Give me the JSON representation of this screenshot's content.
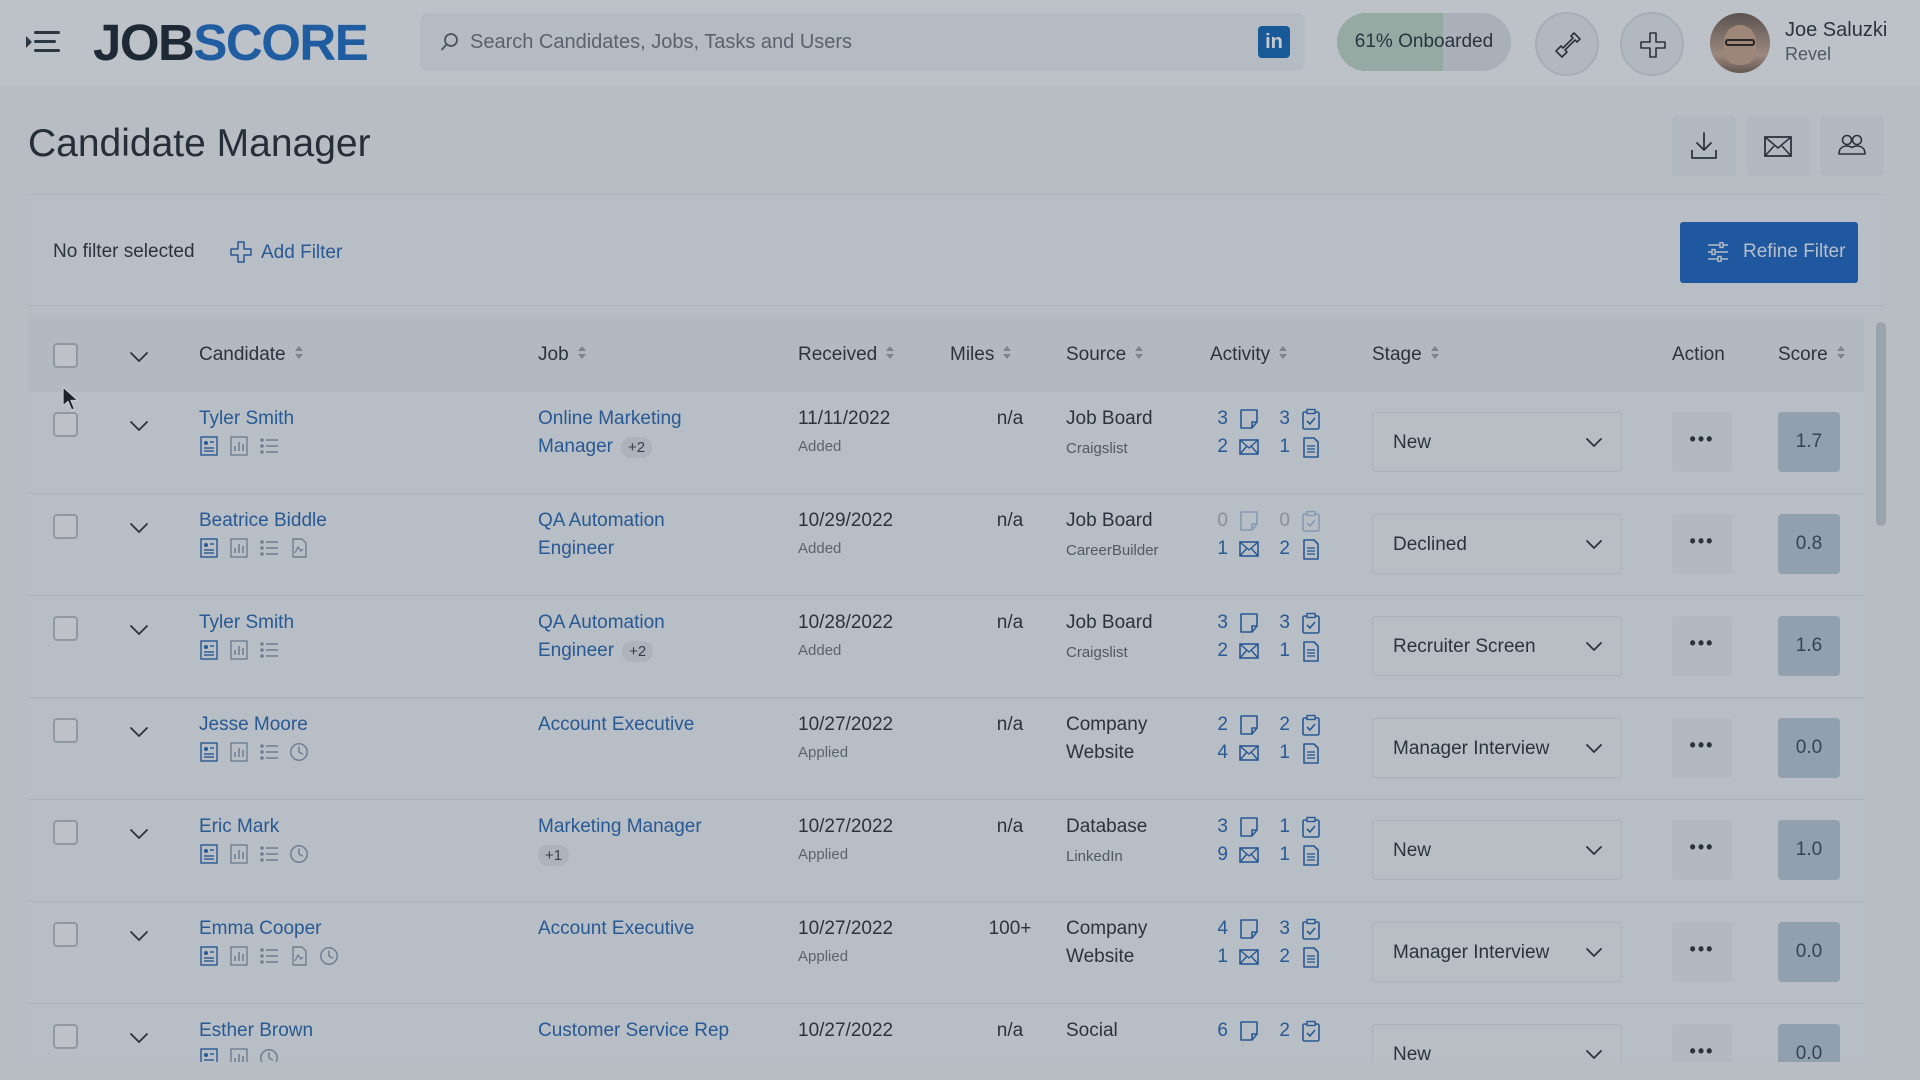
{
  "brand": {
    "logo_part1": "JOB",
    "logo_part2": "SCORE"
  },
  "search": {
    "placeholder": "Search Candidates, Jobs, Tasks and Users",
    "value": ""
  },
  "onboarding": {
    "label": "61% Onboarded",
    "percent": 61
  },
  "user": {
    "name": "Joe Saluzki",
    "org": "Revel"
  },
  "page": {
    "title": "Candidate Manager"
  },
  "filter": {
    "status": "No filter selected",
    "add_label": "Add Filter",
    "refine_label": "Refine Filter"
  },
  "columns": {
    "candidate": "Candidate",
    "job": "Job",
    "received": "Received",
    "miles": "Miles",
    "source": "Source",
    "activity": "Activity",
    "stage": "Stage",
    "action": "Action",
    "score": "Score"
  },
  "rows": [
    {
      "name": "Tyler Smith",
      "icons": [
        "resume-icon",
        "chart-icon",
        "list-icon"
      ],
      "job_l1": "Online Marketing",
      "job_l2": "Manager",
      "job_more": "+2",
      "received": "11/11/2022",
      "received_status": "Added",
      "miles": "n/a",
      "source": "Job Board",
      "source2": "",
      "source_sub": "Craigslist",
      "activity": [
        "3",
        "3",
        "2",
        "1"
      ],
      "stage": "New",
      "score": "1.7"
    },
    {
      "name": "Beatrice Biddle",
      "icons": [
        "resume-icon",
        "chart-icon",
        "list-icon",
        "document-icon"
      ],
      "job_l1": "QA Automation",
      "job_l2": "Engineer",
      "job_more": "",
      "received": "10/29/2022",
      "received_status": "Added",
      "miles": "n/a",
      "source": "Job Board",
      "source2": "",
      "source_sub": "CareerBuilder",
      "activity": [
        "0",
        "0",
        "1",
        "2"
      ],
      "stage": "Declined",
      "score": "0.8"
    },
    {
      "name": "Tyler Smith",
      "icons": [
        "resume-icon",
        "chart-icon",
        "list-icon"
      ],
      "job_l1": "QA Automation",
      "job_l2": "Engineer",
      "job_more": "+2",
      "received": "10/28/2022",
      "received_status": "Added",
      "miles": "n/a",
      "source": "Job Board",
      "source2": "",
      "source_sub": "Craigslist",
      "activity": [
        "3",
        "3",
        "2",
        "1"
      ],
      "stage": "Recruiter Screen",
      "score": "1.6"
    },
    {
      "name": "Jesse Moore",
      "icons": [
        "resume-icon",
        "chart-icon",
        "list-icon",
        "clock-icon"
      ],
      "job_l1": "Account Executive",
      "job_l2": "",
      "job_more": "",
      "received": "10/27/2022",
      "received_status": "Applied",
      "miles": "n/a",
      "source": "Company",
      "source2": "Website",
      "source_sub": "",
      "activity": [
        "2",
        "2",
        "4",
        "1"
      ],
      "stage": "Manager Interview",
      "score": "0.0"
    },
    {
      "name": "Eric Mark",
      "icons": [
        "resume-icon",
        "chart-icon",
        "list-icon",
        "clock-icon"
      ],
      "job_l1": "Marketing Manager",
      "job_l2": "",
      "job_more": "+1",
      "received": "10/27/2022",
      "received_status": "Applied",
      "miles": "n/a",
      "source": "Database",
      "source2": "",
      "source_sub": "LinkedIn",
      "activity": [
        "3",
        "1",
        "9",
        "1"
      ],
      "stage": "New",
      "score": "1.0"
    },
    {
      "name": "Emma Cooper",
      "icons": [
        "resume-icon",
        "chart-icon",
        "list-icon",
        "document-icon",
        "clock-icon"
      ],
      "job_l1": "Account Executive",
      "job_l2": "",
      "job_more": "",
      "received": "10/27/2022",
      "received_status": "Applied",
      "miles": "100+",
      "source": "Company",
      "source2": "Website",
      "source_sub": "",
      "activity": [
        "4",
        "3",
        "1",
        "2"
      ],
      "stage": "Manager Interview",
      "score": "0.0"
    },
    {
      "name": "Esther Brown",
      "icons": [
        "resume-icon",
        "chart-icon",
        "clock-icon"
      ],
      "job_l1": "Customer Service Rep",
      "job_l2": "",
      "job_more": "",
      "received": "10/27/2022",
      "received_status": "",
      "miles": "n/a",
      "source": "Social",
      "source2": "",
      "source_sub": "",
      "activity": [
        "6",
        "2",
        "",
        ""
      ],
      "stage": "New",
      "score": "0.0"
    }
  ]
}
